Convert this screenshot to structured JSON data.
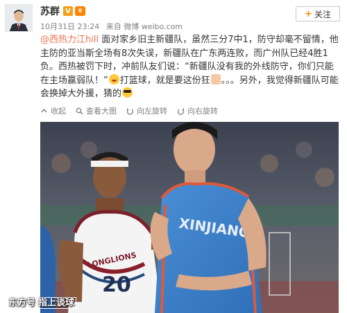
{
  "post": {
    "author": "苏群",
    "verified_badge": "V",
    "member_badge": "会员",
    "time": "10月31日 23:24",
    "source": "来自 微博 weibo.com",
    "follow_label": "关注",
    "text": {
      "mention": "@西热力江hill",
      "t1": " 面对家乡旧主新疆队，虽然三分7中1，防守却毫不留情，他主防的亚当斯全场有8次失误，新疆队在广东两连败，而广州队已经4胜1负。西热被罚下时，冲前队友们说：“新疆队没有我的外线防守，你们只能在主场赢弱队！”",
      "t2": "打篮球，就是要这份狂",
      "t3": "。。。另外，我觉得新疆队可能会换掉大外援，猜的"
    },
    "actions": {
      "collect": "收起",
      "view_large": "查看大图",
      "rotate_left": "向左旋转",
      "rotate_right": "向右旋转"
    },
    "emojis": [
      "laugh-emoji",
      "thumbs-up-emoji",
      "cool-emoji"
    ]
  },
  "photo": {
    "jersey_left_text": "LONGLIONS",
    "jersey_left_number": "20",
    "jersey_right_text": "XINJIANG"
  },
  "watermark": {
    "brand": "东方号",
    "channel": "指上谈球"
  },
  "colors": {
    "link": "#eb7350",
    "accent": "#ff8200",
    "meta": "#808080"
  }
}
